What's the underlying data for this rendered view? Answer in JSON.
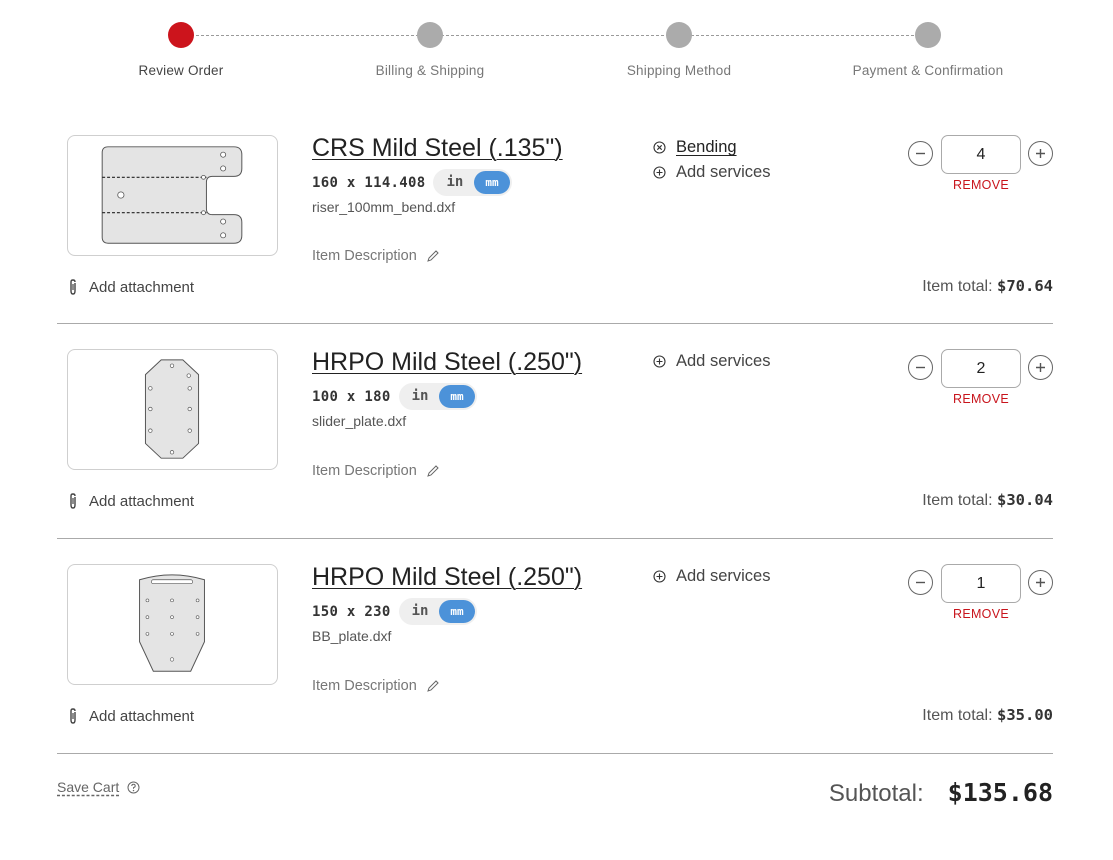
{
  "stepper": {
    "steps": [
      {
        "label": "Review Order",
        "active": true
      },
      {
        "label": "Billing & Shipping",
        "active": false
      },
      {
        "label": "Shipping Method",
        "active": false
      },
      {
        "label": "Payment & Confirmation",
        "active": false
      }
    ]
  },
  "cart": {
    "items": [
      {
        "title": "CRS Mild Steel (.135\")",
        "dimensions": "160 x 114.408",
        "unit_in": "in",
        "unit_mm": "mm",
        "selected_unit": "mm",
        "filename": "riser_100mm_bend.dxf",
        "description_label": "Item Description",
        "attachment_label": "Add attachment",
        "applied_service": "Bending",
        "add_services_label": "Add services",
        "quantity": "4",
        "remove_label": "REMOVE",
        "total_label": "Item total:",
        "total_value": "$70.64"
      },
      {
        "title": "HRPO Mild Steel (.250\")",
        "dimensions": "100 x 180",
        "unit_in": "in",
        "unit_mm": "mm",
        "selected_unit": "mm",
        "filename": "slider_plate.dxf",
        "description_label": "Item Description",
        "attachment_label": "Add attachment",
        "add_services_label": "Add services",
        "quantity": "2",
        "remove_label": "REMOVE",
        "total_label": "Item total:",
        "total_value": "$30.04"
      },
      {
        "title": "HRPO Mild Steel (.250\")",
        "dimensions": "150 x 230",
        "unit_in": "in",
        "unit_mm": "mm",
        "selected_unit": "mm",
        "filename": "BB_plate.dxf",
        "description_label": "Item Description",
        "attachment_label": "Add attachment",
        "add_services_label": "Add services",
        "quantity": "1",
        "remove_label": "REMOVE",
        "total_label": "Item total:",
        "total_value": "$35.00"
      }
    ]
  },
  "footer": {
    "save_cart_label": "Save Cart",
    "subtotal_label": "Subtotal:",
    "subtotal_value": "$135.68"
  },
  "colors": {
    "active_step": "#cc141c",
    "inactive_step": "#ababab",
    "unit_selected": "#4c92d9",
    "remove": "#c8141c"
  },
  "icons": {
    "attachment": "paperclip-icon",
    "edit": "pencil-icon",
    "add_service": "plus-circle-icon",
    "remove_service": "x-circle-icon",
    "help": "question-circle-icon"
  }
}
